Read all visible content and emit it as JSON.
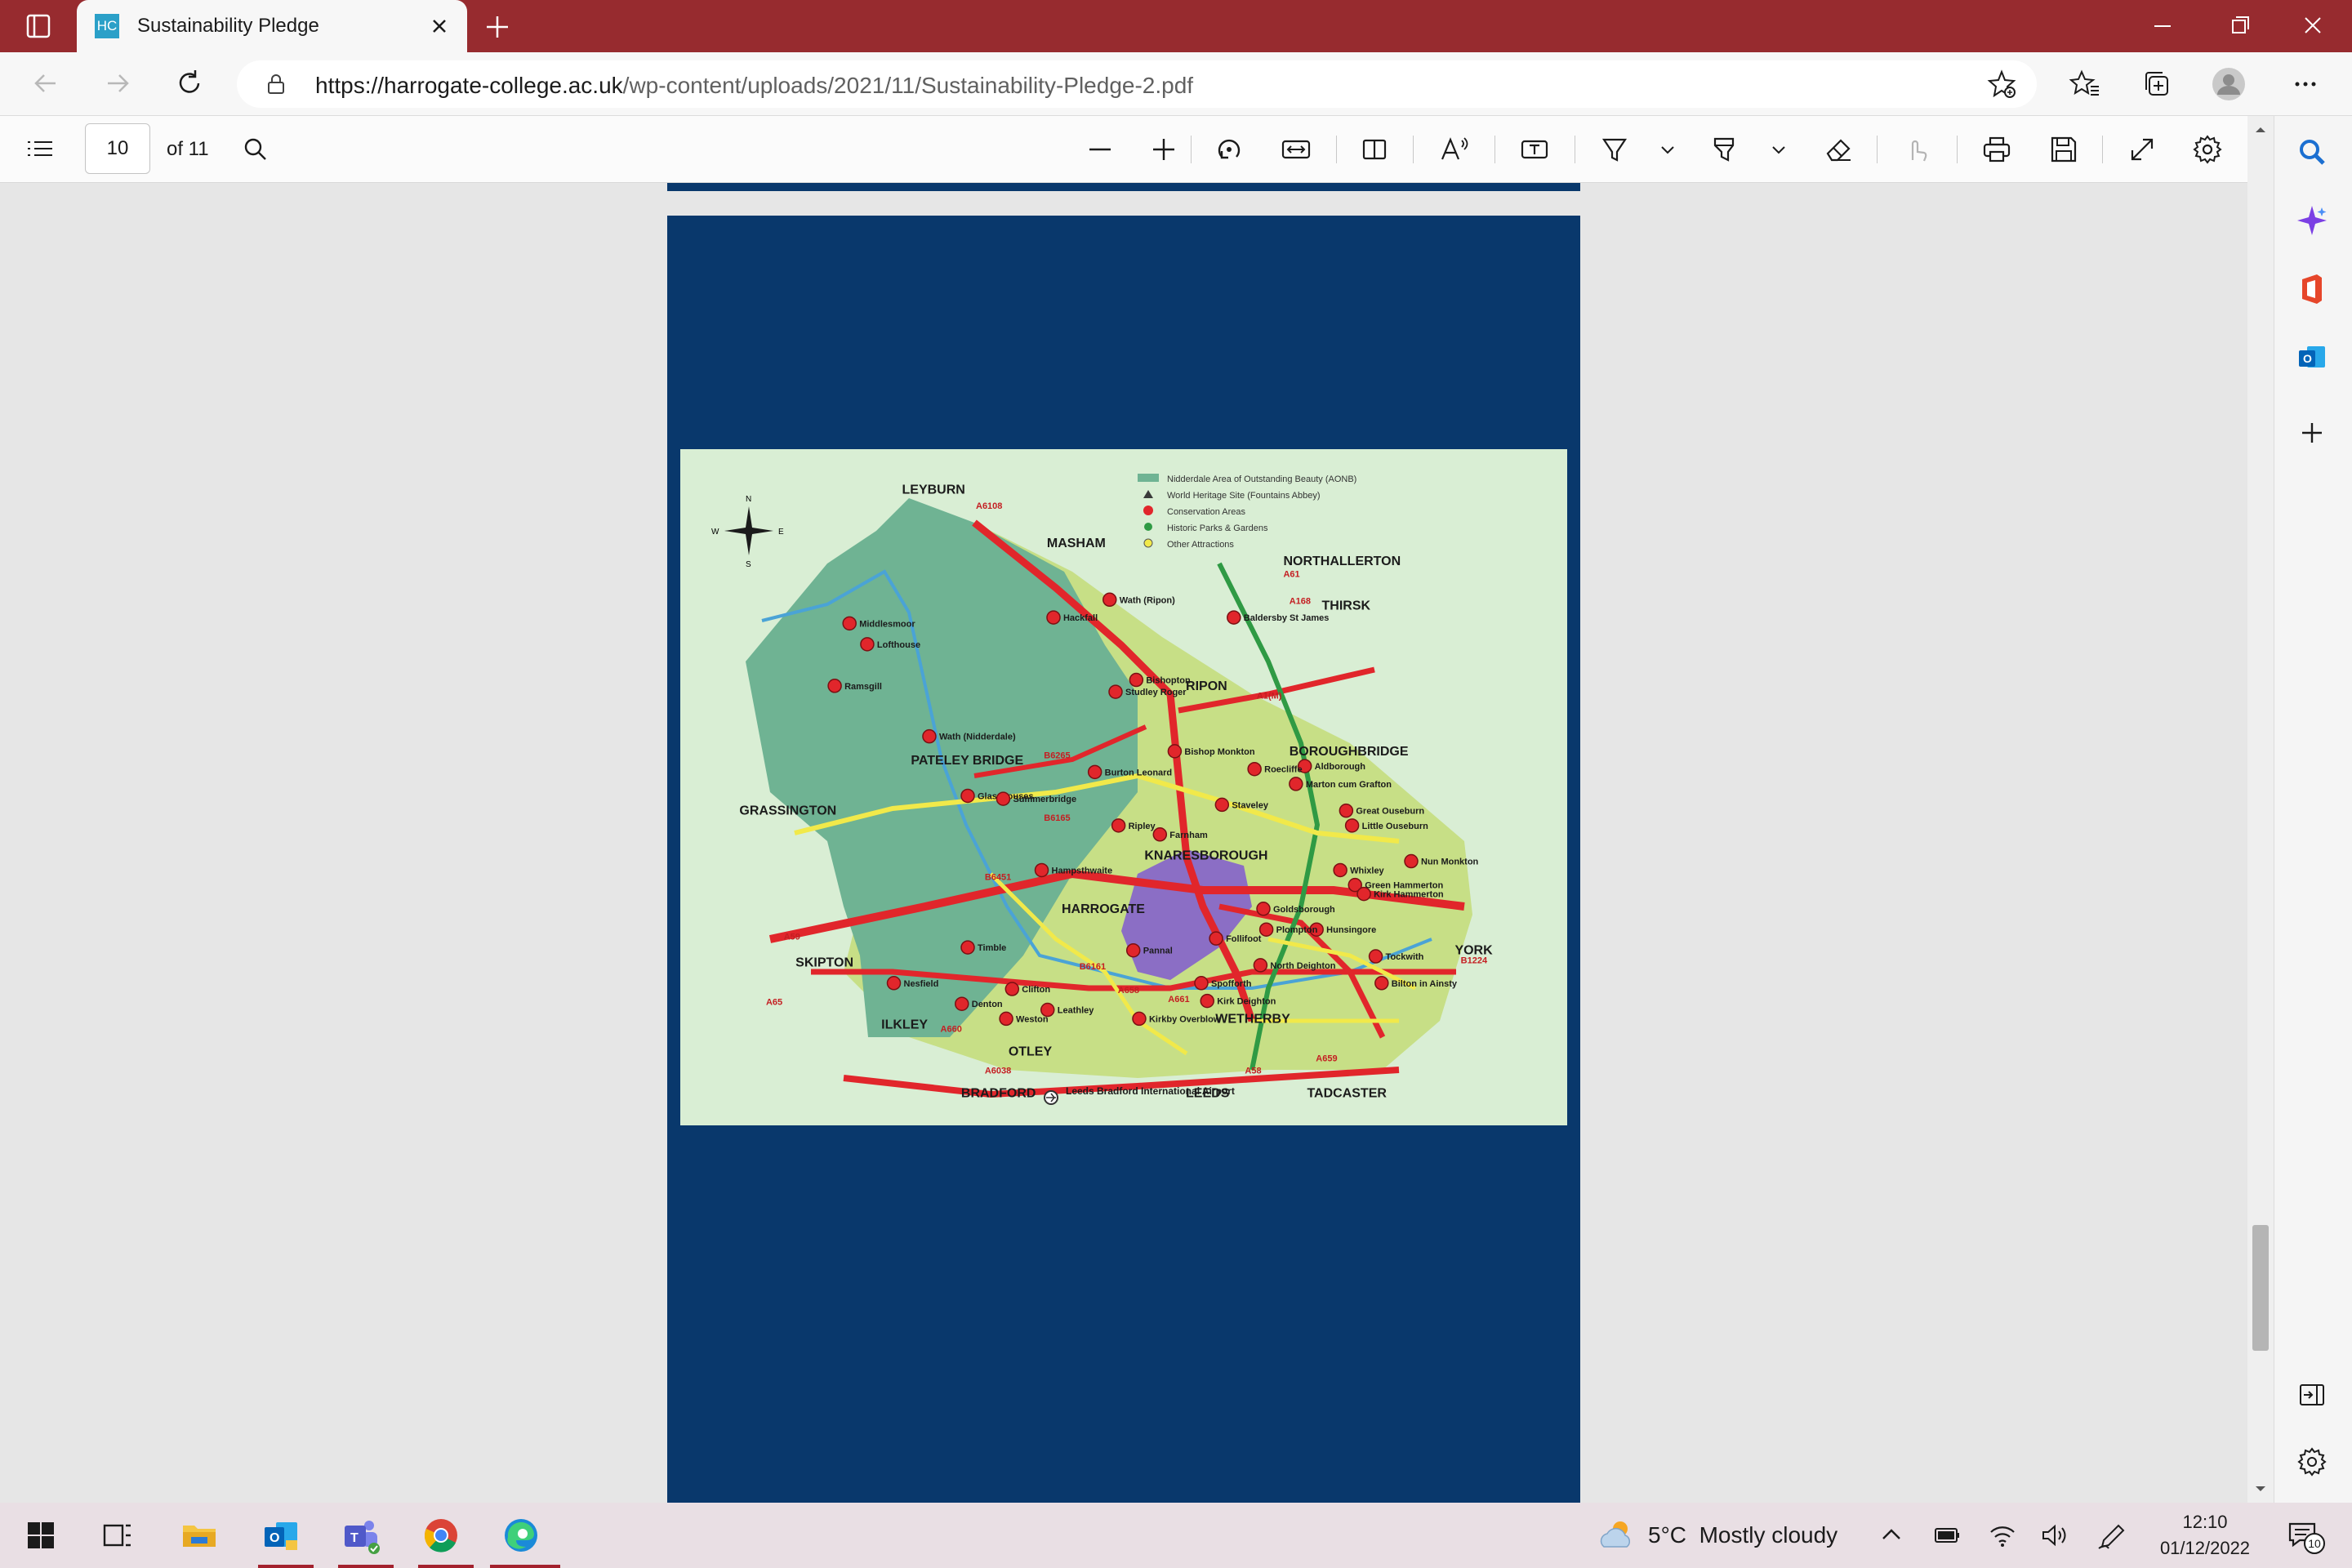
{
  "browser": {
    "tab_title": "Sustainability Pledge",
    "tab_favicon_text": "HC",
    "url_host": "https://harrogate-college.ac.uk",
    "url_path": "/wp-content/uploads/2021/11/Sustainability-Pledge-2.pdf"
  },
  "pdf_toolbar": {
    "page_number": "10",
    "page_count_label": "of 11"
  },
  "map": {
    "legend": [
      {
        "label": "Nidderdale Area of Outstanding Beauty (AONB)",
        "color": "#6fb393",
        "marker": "square"
      },
      {
        "label": "World Heritage Site (Fountains Abbey)",
        "color": "#3a3a3a",
        "marker": "triangle"
      },
      {
        "label": "Conservation Areas",
        "color": "#e1262b",
        "marker": "circle"
      },
      {
        "label": "Historic Parks & Gardens",
        "color": "#2f9a44",
        "marker": "circle"
      },
      {
        "label": "Other Attractions",
        "color": "#f1e94a",
        "marker": "circle"
      }
    ],
    "compass": {
      "n": "N",
      "s": "S",
      "e": "E",
      "w": "W"
    },
    "towns": [
      "LEYBURN",
      "MASHAM",
      "NORTHALLERTON",
      "THIRSK",
      "RIPON",
      "BOROUGHBRIDGE",
      "PATELEY BRIDGE",
      "GRASSINGTON",
      "KNARESBOROUGH",
      "HARROGATE",
      "SKIPTON",
      "YORK",
      "ILKLEY",
      "WETHERBY",
      "OTLEY",
      "BRADFORD",
      "LEEDS",
      "TADCASTER"
    ],
    "places": [
      "Middlesmoor",
      "Lofthouse",
      "Ramsgill",
      "Wath (Nidderdale)",
      "Hackfall",
      "Wath (Ripon)",
      "Baldersby St James",
      "Bishopton",
      "Studley Roger",
      "Bishop Monkton",
      "Aldborough",
      "Roecliffe",
      "Marton cum Grafton",
      "Burton Leonard",
      "Glasshouses",
      "Summerbridge",
      "Staveley",
      "Great Ouseburn",
      "Little Ouseburn",
      "Farnham",
      "Ripley",
      "Hampsthwaite",
      "Whixley",
      "Nun Monkton",
      "Green Hammerton",
      "Kirk Hammerton",
      "Goldsborough",
      "Hunsingore",
      "Plompton",
      "Follifoot",
      "Pannal",
      "Tockwith",
      "North Deighton",
      "Bilton in Ainsty",
      "Timble",
      "Spofforth",
      "Kirk Deighton",
      "Nesfield",
      "Clifton",
      "Denton",
      "Weston",
      "Leathley",
      "Kirkby Overblow"
    ],
    "roads": [
      "A6108",
      "A61",
      "A168",
      "A1(M)",
      "B6265",
      "A59",
      "B6165",
      "B6451",
      "A658",
      "B6161",
      "A661",
      "A65",
      "A660",
      "A6038",
      "A58",
      "A659",
      "B1224"
    ],
    "airport": "Leeds Bradford International Airport"
  },
  "taskbar": {
    "weather_temp": "5°C",
    "weather_desc": "Mostly cloudy",
    "time": "12:10",
    "date": "01/12/2022",
    "notification_count": "10"
  },
  "colors": {
    "titlebar": "#972b2f",
    "page_bg": "#09386c",
    "map_bg": "#d9eed4",
    "aonb": "#6fb393",
    "road_red": "#e1262b",
    "road_yellow": "#f1e94a",
    "road_green": "#2f9a44",
    "harrogate_purple": "#8b6ec5"
  }
}
